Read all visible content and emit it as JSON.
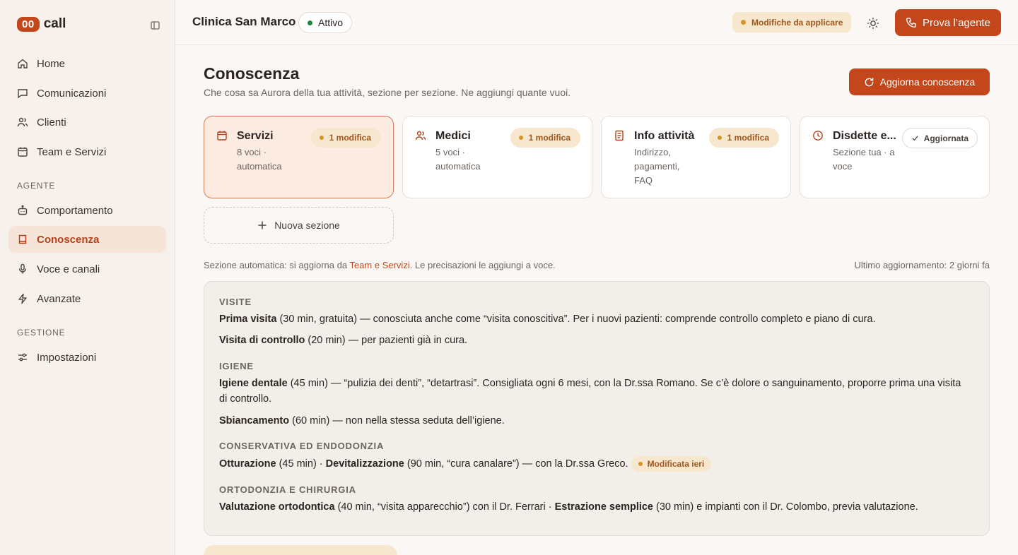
{
  "logo": {
    "badge": "00",
    "text": "call"
  },
  "sidebar": {
    "items": [
      {
        "label": "Home",
        "icon": "home-icon"
      },
      {
        "label": "Comunicazioni",
        "icon": "chat-icon"
      },
      {
        "label": "Clienti",
        "icon": "users-icon"
      },
      {
        "label": "Team e Servizi",
        "icon": "calendar-icon"
      }
    ],
    "section_agente": "AGENTE",
    "agente_items": [
      {
        "label": "Comportamento",
        "icon": "robot-icon"
      },
      {
        "label": "Conoscenza",
        "icon": "book-icon",
        "active": true
      },
      {
        "label": "Voce e canali",
        "icon": "microphone-icon"
      },
      {
        "label": "Avanzate",
        "icon": "lightning-icon"
      }
    ],
    "section_gestione": "GESTIONE",
    "gestione_items": [
      {
        "label": "Impostazioni",
        "icon": "sliders-icon"
      }
    ]
  },
  "header": {
    "clinic_name": "Clinica San Marco",
    "status": "Attivo",
    "status_color": "#1f8a3b",
    "pending": "Modifiche da applicare",
    "try_agent": "Prova l’agente"
  },
  "main": {
    "title": "Conoscenza",
    "subtitle": "Che cosa sa Aurora della tua attività, sezione per sezione. Ne aggiungi quante vuoi.",
    "refresh_button": "Aggiorna conoscenza",
    "cards": [
      {
        "title": "Servizi",
        "sub": "8 voci · automatica",
        "badge": "1 modifica",
        "icon": "calendar-icon"
      },
      {
        "title": "Medici",
        "sub": "5 voci · automatica",
        "badge": "1 modifica",
        "icon": "users-icon"
      },
      {
        "title": "Info attività",
        "sub": "Indirizzo, pagamenti, FAQ",
        "badge": "1 modifica",
        "icon": "document-icon"
      },
      {
        "title": "Disdette e...",
        "sub": "Sezione tua · a voce",
        "badge": "Aggiornata",
        "icon": "clock-icon"
      }
    ],
    "new_section": "Nuova sezione",
    "auto_note_prefix": "Sezione automatica: si aggiorna da ",
    "auto_note_link": "Team e Servizi",
    "auto_note_suffix": ". Le precisazioni le aggiungi a voce.",
    "last_update": "Ultimo aggiornamento: 2 giorni fa",
    "accent_color": "#c4471c",
    "warning_color": "#d4962a"
  },
  "kb": {
    "visite_heading": "VISITE",
    "prima_visita_name": "Prima visita",
    "prima_visita_text": " (30 min, gratuita) — conosciuta anche come “visita conoscitiva”. Per i nuovi pazienti: comprende controllo completo e piano di cura.",
    "controllo_name": "Visita di controllo",
    "controllo_text": " (20 min) — per pazienti già in cura.",
    "igiene_heading": "IGIENE",
    "igiene_name": "Igiene dentale",
    "igiene_text": " (45 min) — “pulizia dei denti”, “detartrasi”. Consigliata ogni 6 mesi, con la Dr.ssa Romano. Se c’è dolore o sanguinamento, proporre prima una visita di controllo.",
    "sbiancamento_name": "Sbiancamento",
    "sbiancamento_text": " (60 min) — non nella stessa seduta dell’igiene.",
    "conservativa_heading": "CONSERVATIVA ED ENDODONZIA",
    "otturazione_name": "Otturazione",
    "otturazione_text": " (45 min) · ",
    "devital_name": "Devitalizzazione",
    "devital_text": " (90 min, “cura canalare”) — con la Dr.ssa Greco.",
    "modified_badge": "Modificata ieri",
    "ortodonzia_heading": "ORTODONZIA E CHIRURGIA",
    "valutazione_name": "Valutazione ortodontica",
    "valutazione_text": " (40 min, “visita apparecchio”) con il Dr. Ferrari · ",
    "estrazione_name": "Estrazione semplice",
    "estrazione_text": " (30 min) e impianti con il Dr. Colombo, previa valutazione."
  }
}
